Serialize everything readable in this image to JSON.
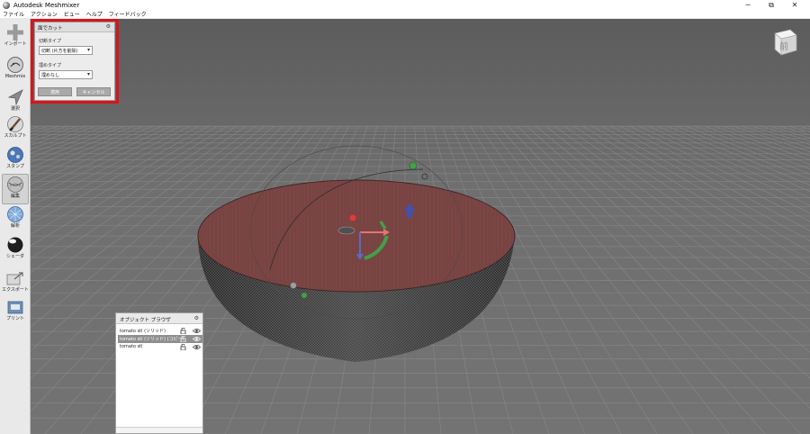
{
  "window": {
    "title": "Autodesk Meshmixer",
    "controls": [
      "─",
      "⧉",
      "✕"
    ]
  },
  "menu": [
    "ファイル",
    "アクション",
    "ビュー",
    "ヘルプ",
    "フィードバック"
  ],
  "toolbar": {
    "items": [
      {
        "label": "インポート",
        "icon": "plus-icon"
      },
      {
        "label": "Meshmix",
        "icon": "meshmix-sphere-icon"
      },
      {
        "label": "選択",
        "icon": "select-arrow-icon"
      },
      {
        "label": "スカルプト",
        "icon": "brush-icon"
      },
      {
        "label": "スタンプ",
        "icon": "stamp-icon"
      },
      {
        "label": "編集",
        "icon": "edit-icon"
      },
      {
        "label": "解析",
        "icon": "analysis-icon"
      },
      {
        "label": "シェーダ",
        "icon": "shader-ball-icon"
      },
      {
        "label": "エクスポート",
        "icon": "export-icon"
      },
      {
        "label": "プリント",
        "icon": "print-icon"
      }
    ],
    "active_index": 5
  },
  "cut_panel": {
    "title": "面でカット",
    "close_icon": "⚙",
    "cut_type_label": "切断タイプ",
    "cut_type_value": "切断 (片方を削除)",
    "fill_type_label": "埋めタイプ",
    "fill_type_value": "埋めなし",
    "apply_label": "適用",
    "cancel_label": "キャンセル",
    "highlight_color": "#d9141b"
  },
  "viewcube": {
    "label": "前"
  },
  "object_browser": {
    "title": "オブジェクト ブラウザ",
    "close_icon": "⚙",
    "items": [
      {
        "name": "tomato stl (ソリッド)",
        "selected": false
      },
      {
        "name": "tomato stl (ソリッド) (コピー)",
        "selected": true
      },
      {
        "name": "tomato stl",
        "selected": false
      }
    ]
  },
  "colors": {
    "viewport_background": "#6f6f6f",
    "cut_face": "#7a4446",
    "mesh": "#2e2e2e",
    "gizmo_red": "#e53935",
    "gizmo_green": "#43a047",
    "gizmo_blue": "#3949ab"
  }
}
